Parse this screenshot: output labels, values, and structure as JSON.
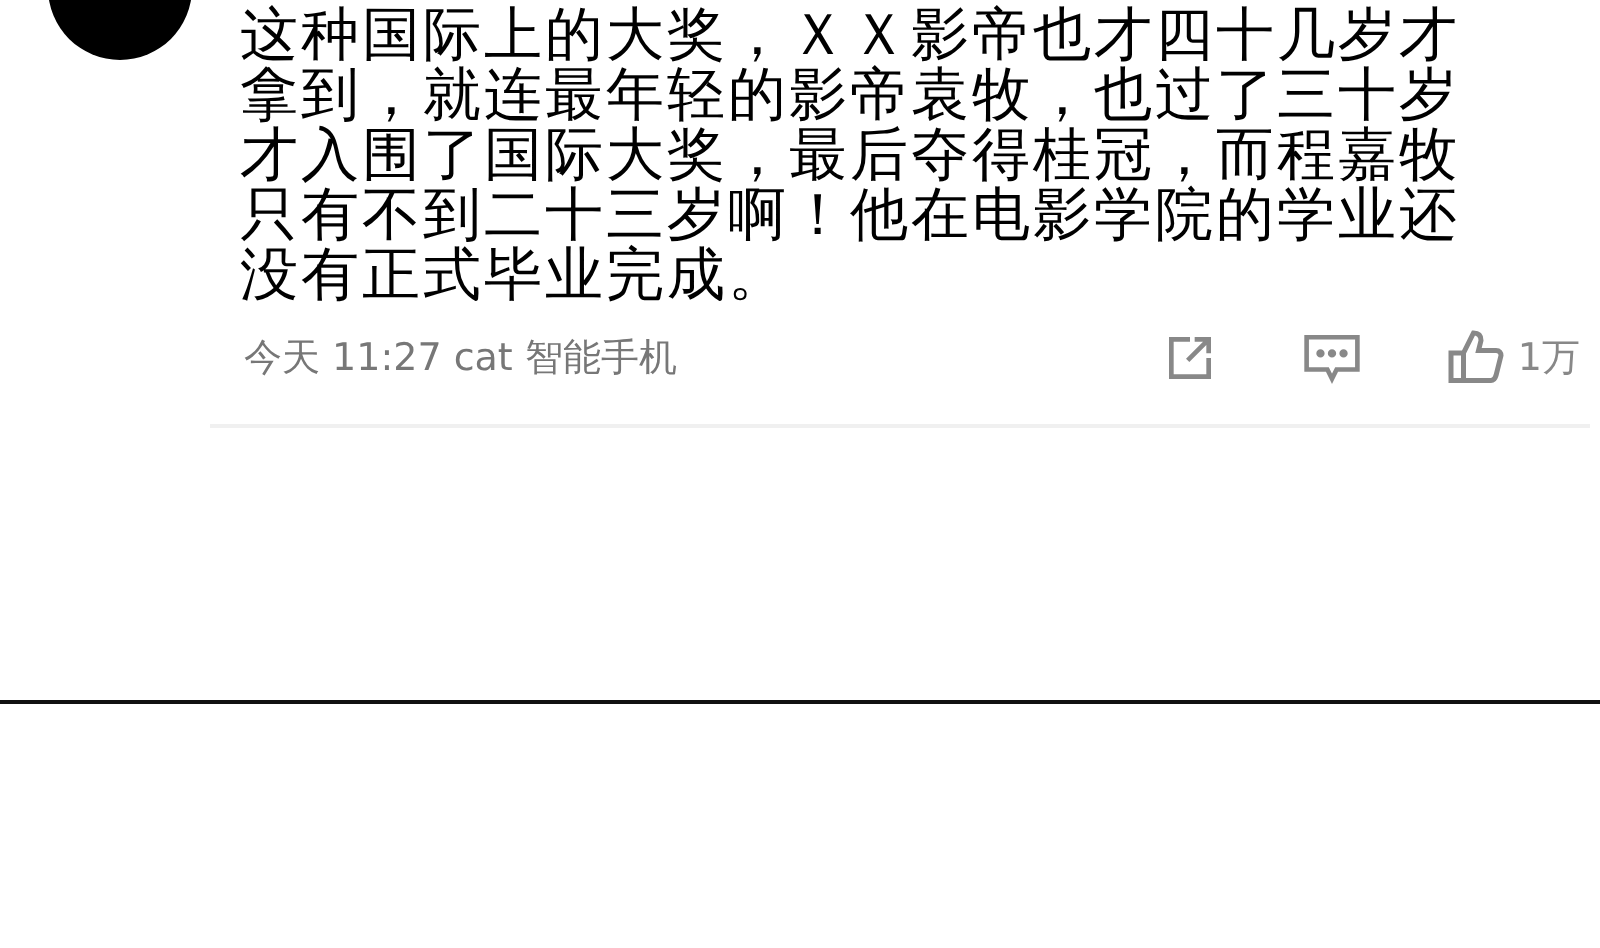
{
  "comment": {
    "text": "这种国际上的大奖，ＸＸ影帝也才四十几岁才拿到，就连最年轻的影帝袁牧，也过了三十岁才入围了国际大奖，最后夺得桂冠，而程嘉牧只有不到二十三岁啊！他在电影学院的学业还没有正式毕业完成。",
    "meta": "今天 11:27 cat 智能手机",
    "like_count": "1万"
  }
}
